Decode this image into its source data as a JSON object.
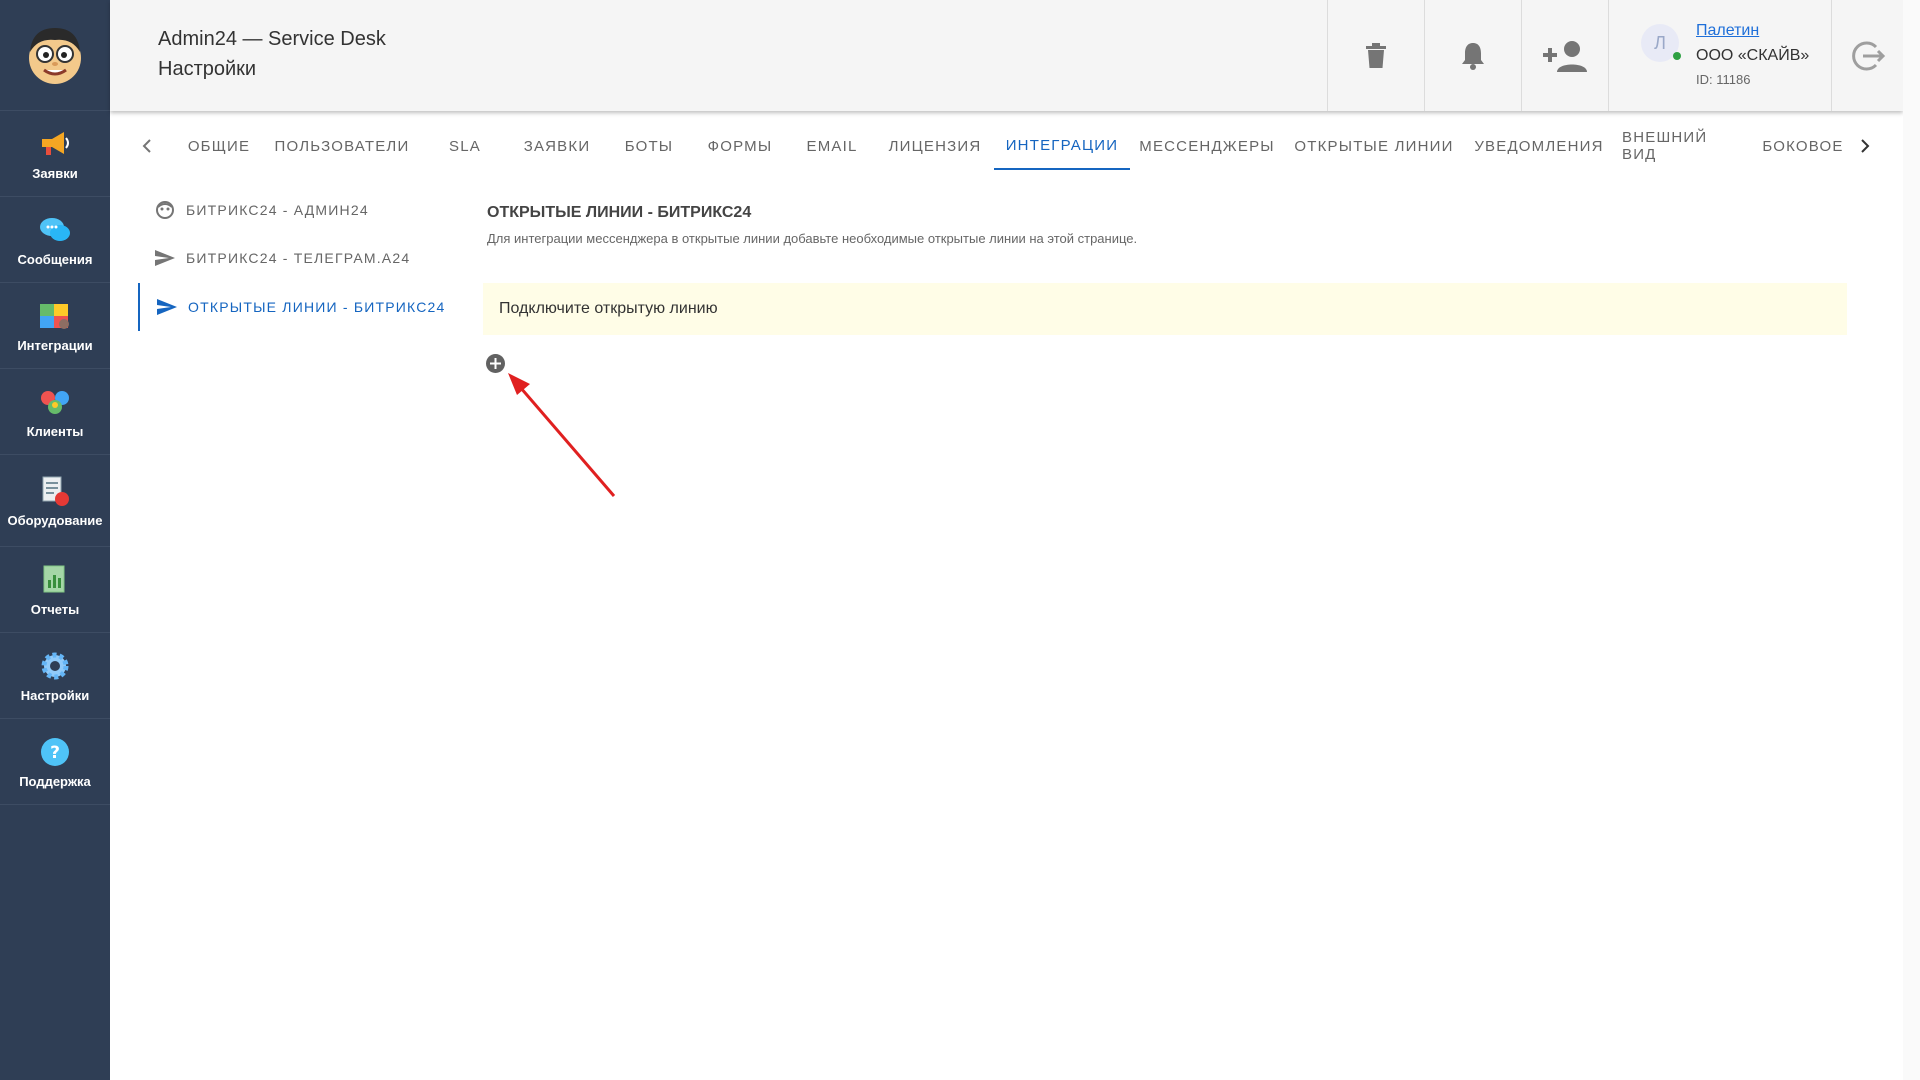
{
  "sidebar": {
    "items": [
      {
        "label": "Заявки",
        "icon": "megaphone-icon"
      },
      {
        "label": "Сообщения",
        "icon": "chat-bubbles-icon"
      },
      {
        "label": "Интеграции",
        "icon": "puzzle-icon"
      },
      {
        "label": "Клиенты",
        "icon": "people-icon"
      },
      {
        "label": "Оборудование",
        "icon": "equipment-icon"
      },
      {
        "label": "Отчеты",
        "icon": "report-icon"
      },
      {
        "label": "Настройки",
        "icon": "gear-icon"
      },
      {
        "label": "Поддержка",
        "icon": "help-icon"
      }
    ]
  },
  "header": {
    "app_title": "Admin24 — Service Desk",
    "page_title": "Настройки",
    "user": {
      "initial": "Л",
      "name": "Палетин",
      "org": "ООО «СКАЙВ»",
      "id": "ID: 11186"
    }
  },
  "tabs": [
    {
      "label": "ОБЩИЕ"
    },
    {
      "label": "ПОЛЬЗОВАТЕЛИ"
    },
    {
      "label": "SLA"
    },
    {
      "label": "ЗАЯВКИ"
    },
    {
      "label": "БОТЫ"
    },
    {
      "label": "ФОРМЫ"
    },
    {
      "label": "EMAIL"
    },
    {
      "label": "ЛИЦЕНЗИЯ"
    },
    {
      "label": "ИНТЕГРАЦИИ",
      "active": true
    },
    {
      "label": "МЕССЕНДЖЕРЫ"
    },
    {
      "label": "ОТКРЫТЫЕ ЛИНИИ"
    },
    {
      "label": "УВЕДОМЛЕНИЯ"
    },
    {
      "label": "ВНЕШНИЙ ВИД"
    },
    {
      "label": "БОКОВОЕ"
    }
  ],
  "submenu": [
    {
      "label": "БИТРИКС24 - АДМИН24",
      "icon": "face-icon"
    },
    {
      "label": "БИТРИКС24 - ТЕЛЕГРАМ.А24",
      "icon": "send-icon"
    },
    {
      "label": "ОТКРЫТЫЕ ЛИНИИ - БИТРИКС24",
      "icon": "send-icon",
      "active": true
    }
  ],
  "content": {
    "title": "ОТКРЫТЫЕ ЛИНИИ - БИТРИКС24",
    "description": "Для интеграции мессенджера в открытые линии добавьте необходимые открытые линии на этой странице.",
    "alert": "Подключите открытую линию"
  },
  "colors": {
    "sidebar_bg": "#2f3e55",
    "accent": "#1565c0",
    "alert_bg": "#fffde7",
    "annotation_arrow": "#e02020"
  }
}
